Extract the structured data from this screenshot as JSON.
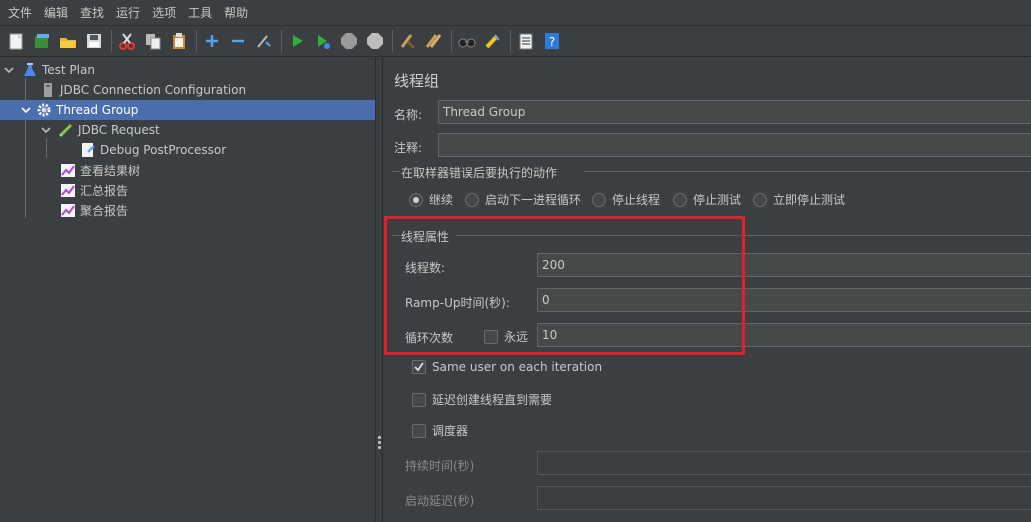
{
  "menu": [
    "文件",
    "编辑",
    "查找",
    "运行",
    "选项",
    "工具",
    "帮助"
  ],
  "toolbar": {
    "icons": [
      "new-icon",
      "templates-icon",
      "open-icon",
      "save-icon",
      "cut-icon",
      "copy-icon",
      "paste-icon",
      "expand-icon",
      "collapse-icon",
      "toggle-icon",
      "start-icon",
      "start-no-pause-icon",
      "stop-icon",
      "shutdown-icon",
      "clear-icon",
      "clear-all-icon",
      "search-icon",
      "reset-search-icon",
      "function-helper-icon",
      "help-icon"
    ]
  },
  "tree": {
    "items": [
      {
        "label": "Test Plan",
        "icon": "test-plan-icon"
      },
      {
        "label": "JDBC Connection Configuration",
        "icon": "config-element-icon"
      },
      {
        "label": "Thread Group",
        "icon": "thread-group-gear-icon",
        "selected": true
      },
      {
        "label": "JDBC Request",
        "icon": "sampler-pencil-icon"
      },
      {
        "label": "Debug PostProcessor",
        "icon": "postprocessor-icon"
      },
      {
        "label": "查看结果树",
        "icon": "listener-chart-icon"
      },
      {
        "label": "汇总报告",
        "icon": "listener-chart-icon"
      },
      {
        "label": "聚合报告",
        "icon": "listener-chart-icon"
      }
    ]
  },
  "panel": {
    "title": "线程组",
    "name_label": "名称:",
    "name_value": "Thread Group",
    "comment_label": "注释:",
    "comment_value": "",
    "error_action": {
      "title": "在取样器错误后要执行的动作",
      "options": [
        "继续",
        "启动下一进程循环",
        "停止线程",
        "停止测试",
        "立即停止测试"
      ],
      "selected": "继续"
    },
    "thread_props": {
      "title": "线程属性",
      "threads_label": "线程数:",
      "threads_value": "200",
      "rampup_label": "Ramp-Up时间(秒):",
      "rampup_value": "0",
      "loop_label": "循环次数",
      "forever_label": "永远",
      "forever_checked": false,
      "loop_value": "10"
    },
    "same_user_label": "Same user on each iteration",
    "same_user_checked": true,
    "delay_create_label": "延迟创建线程直到需要",
    "delay_create_checked": false,
    "scheduler_label": "调度器",
    "scheduler_checked": false,
    "duration_label": "持续时间(秒)",
    "duration_value": "",
    "startup_delay_label": "启动延迟(秒)",
    "startup_delay_value": ""
  },
  "colors": {
    "background": "#3c3f41",
    "selection": "#4b6eaf",
    "highlight_border": "#e0202a"
  }
}
